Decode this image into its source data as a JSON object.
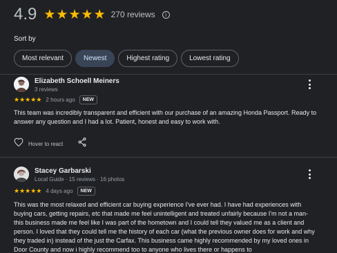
{
  "summary": {
    "rating": "4.9",
    "stars": [
      "★",
      "★",
      "★",
      "★",
      "★"
    ],
    "review_count": "270 reviews",
    "info_glyph": "i"
  },
  "sort": {
    "label": "Sort by",
    "options": [
      "Most relevant",
      "Newest",
      "Highest rating",
      "Lowest rating"
    ],
    "selected": "Newest"
  },
  "reviews": [
    {
      "author": "Elizabeth Schoell Meiners",
      "meta": "3 reviews",
      "stars": [
        "★",
        "★",
        "★",
        "★",
        "★"
      ],
      "time": "2 hours ago",
      "badge": "NEW",
      "text": "This team was incredibly transparent and efficient with our purchase of an amazing Honda Passport. Ready to answer any question and I had a lot. Patient, honest and easy to work with.",
      "react_label": "Hover to react"
    },
    {
      "author": "Stacey Garbarski",
      "meta": "Local Guide · 15 reviews · 16 photos",
      "stars": [
        "★",
        "★",
        "★",
        "★",
        "★"
      ],
      "time": "4 days ago",
      "badge": "NEW",
      "text": "This was the most relaxed and efficient car buying experience I've ever had. I have had experiences with buying cars, getting repairs, etc that made me feel unintelligent and treated unfairly because I'm not a man- this business made me feel like I was part of the hometown and I could tell they valued me as a client and person. I loved that they could tell me the history of each car (what the previous owner does for work and why they traded in) instead of the just the Carfax. This business came highly recommended by my loved ones in Door County and now i highly recommend too to anyone who lives there or happens to"
    }
  ],
  "colors": {
    "star": "#fbbc04",
    "selected_chip": "#394457",
    "background": "#202124"
  },
  "icons": [
    "info-icon",
    "heart-icon",
    "share-icon",
    "more-vert-icon",
    "avatar"
  ]
}
